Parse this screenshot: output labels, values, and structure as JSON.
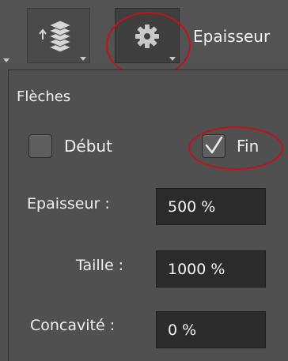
{
  "toolbar": {
    "title": "Epaisseur",
    "icons": [
      "layers-arrow-icon",
      "gear-icon"
    ]
  },
  "arrows_panel": {
    "section_title": "Flèches",
    "start_checkbox": {
      "label": "Début",
      "checked": false
    },
    "end_checkbox": {
      "label": "Fin",
      "checked": true
    },
    "fields": [
      {
        "label": "Epaisseur :",
        "value": "500 %"
      },
      {
        "label": "Taille :",
        "value": "1000 %"
      },
      {
        "label": "Concavité :",
        "value": "0 %"
      }
    ]
  },
  "colors": {
    "annotation_red": "#c0131a",
    "panel_bg": "#505050",
    "field_bg": "#2b2b2b"
  }
}
